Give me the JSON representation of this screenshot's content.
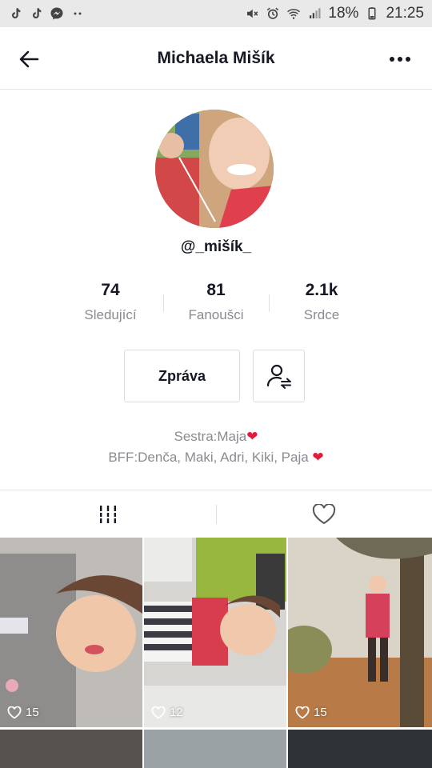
{
  "status_bar": {
    "battery": "18%",
    "time": "21:25",
    "left_icons": [
      "tiktok-icon",
      "tiktok-icon",
      "messenger-icon",
      "more-dots-icon"
    ],
    "right_icons": [
      "mute-icon",
      "alarm-icon",
      "wifi-icon",
      "signal-icon",
      "battery-icon"
    ]
  },
  "header": {
    "title": "Michaela Mišík",
    "back_icon": "arrow-left-icon",
    "more_icon": "more-horizontal-icon"
  },
  "profile": {
    "username": "@_mišík_",
    "stats": [
      {
        "value": "74",
        "label": "Sledující"
      },
      {
        "value": "81",
        "label": "Fanoušci"
      },
      {
        "value": "2.1k",
        "label": "Srdce"
      }
    ],
    "message_button": "Zpráva",
    "bio_line1": "Sestra:Maja",
    "bio_line2": "BFF:Denča, Maki, Adri, Kiki, Paja ",
    "bio_emoji": "❤"
  },
  "tabs": [
    {
      "icon": "videos-grid-icon"
    },
    {
      "icon": "heart-outline-icon"
    }
  ],
  "videos": [
    {
      "likes": "15"
    },
    {
      "likes": "12"
    },
    {
      "likes": "15"
    }
  ],
  "colors": {
    "text_primary": "#161823",
    "text_secondary": "#8a8b91",
    "heart_red": "#e21b3c",
    "divider": "#e4e4e4"
  }
}
